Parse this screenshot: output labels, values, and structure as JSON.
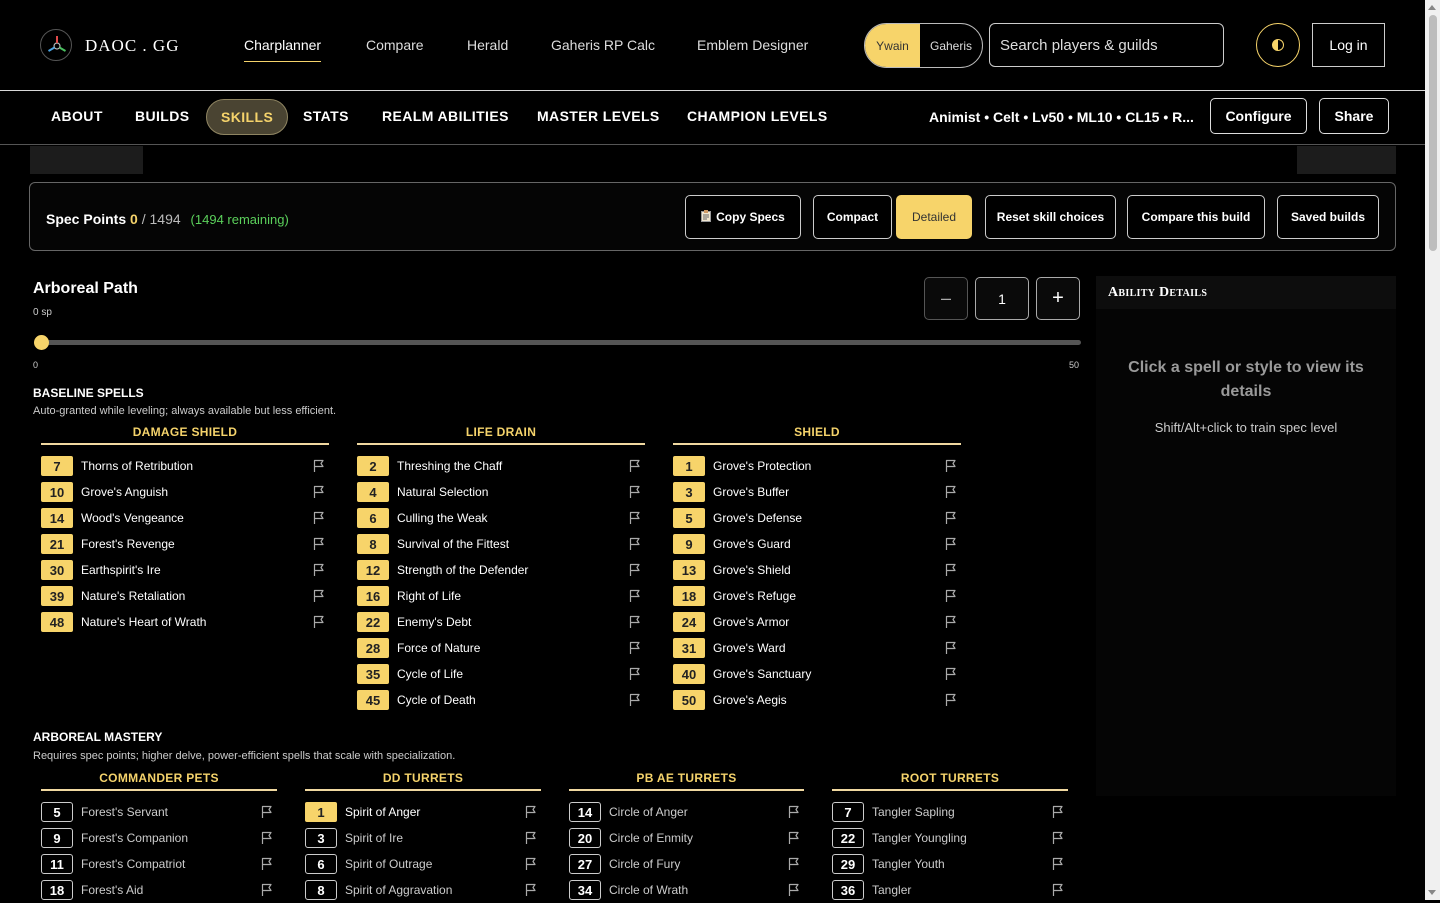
{
  "header": {
    "logo_text": "DAOC . GG",
    "nav": [
      "Charplanner",
      "Compare",
      "Herald",
      "Gaheris RP Calc",
      "Emblem Designer"
    ],
    "realm_options": [
      "Ywain",
      "Gaheris"
    ],
    "search_placeholder": "Search players & guilds",
    "login_label": "Log in"
  },
  "subnav": {
    "tabs": [
      "ABOUT",
      "BUILDS",
      "SKILLS",
      "STATS",
      "REALM ABILITIES",
      "MASTER LEVELS",
      "CHAMPION LEVELS"
    ],
    "active_tab": "SKILLS",
    "build_summary": "Animist • Celt • Lv50 • ML10 • CL15 • R...",
    "configure_label": "Configure",
    "share_label": "Share"
  },
  "spec": {
    "label": "Spec Points",
    "used": "0",
    "total": "/ 1494",
    "remaining": "(1494 remaining)",
    "buttons": [
      "Copy Specs",
      "Compact",
      "Detailed",
      "Reset skill choices",
      "Compare this build",
      "Saved builds"
    ],
    "active_view": "Detailed"
  },
  "tree": {
    "title": "Arboreal Path",
    "sp": "0 sp",
    "minus": "–",
    "level": "1",
    "plus": "+",
    "slider_min": "0",
    "slider_max": "50",
    "slider_value": 1
  },
  "baseline": {
    "title": "BASELINE SPELLS",
    "desc": "Auto-granted while leveling; always available but less efficient.",
    "columns": [
      {
        "title": "DAMAGE SHIELD",
        "spells": [
          {
            "lvl": "7",
            "name": "Thorns of Retribution"
          },
          {
            "lvl": "10",
            "name": "Grove's Anguish"
          },
          {
            "lvl": "14",
            "name": "Wood's Vengeance"
          },
          {
            "lvl": "21",
            "name": "Forest's Revenge"
          },
          {
            "lvl": "30",
            "name": "Earthspirit's Ire"
          },
          {
            "lvl": "39",
            "name": "Nature's Retaliation"
          },
          {
            "lvl": "48",
            "name": "Nature's Heart of Wrath"
          }
        ]
      },
      {
        "title": "LIFE DRAIN",
        "spells": [
          {
            "lvl": "2",
            "name": "Threshing the Chaff"
          },
          {
            "lvl": "4",
            "name": "Natural Selection"
          },
          {
            "lvl": "6",
            "name": "Culling the Weak"
          },
          {
            "lvl": "8",
            "name": "Survival of the Fittest"
          },
          {
            "lvl": "12",
            "name": "Strength of the Defender"
          },
          {
            "lvl": "16",
            "name": "Right of Life"
          },
          {
            "lvl": "22",
            "name": "Enemy's Debt"
          },
          {
            "lvl": "28",
            "name": "Force of Nature"
          },
          {
            "lvl": "35",
            "name": "Cycle of Life"
          },
          {
            "lvl": "45",
            "name": "Cycle of Death"
          }
        ]
      },
      {
        "title": "SHIELD",
        "spells": [
          {
            "lvl": "1",
            "name": "Grove's Protection"
          },
          {
            "lvl": "3",
            "name": "Grove's Buffer"
          },
          {
            "lvl": "5",
            "name": "Grove's Defense"
          },
          {
            "lvl": "9",
            "name": "Grove's Guard"
          },
          {
            "lvl": "13",
            "name": "Grove's Shield"
          },
          {
            "lvl": "18",
            "name": "Grove's Refuge"
          },
          {
            "lvl": "24",
            "name": "Grove's Armor"
          },
          {
            "lvl": "31",
            "name": "Grove's Ward"
          },
          {
            "lvl": "40",
            "name": "Grove's Sanctuary"
          },
          {
            "lvl": "50",
            "name": "Grove's Aegis"
          }
        ]
      }
    ]
  },
  "mastery": {
    "title": "ARBOREAL MASTERY",
    "desc": "Requires spec points; higher delve, power-efficient spells that scale with specialization.",
    "columns": [
      {
        "title": "COMMANDER PETS",
        "spells": [
          {
            "lvl": "5",
            "name": "Forest's Servant"
          },
          {
            "lvl": "9",
            "name": "Forest's Companion"
          },
          {
            "lvl": "11",
            "name": "Forest's Compatriot"
          },
          {
            "lvl": "18",
            "name": "Forest's Aid"
          }
        ]
      },
      {
        "title": "DD TURRETS",
        "spells": [
          {
            "lvl": "1",
            "name": "Spirit of Anger",
            "trained": true
          },
          {
            "lvl": "3",
            "name": "Spirit of Ire"
          },
          {
            "lvl": "6",
            "name": "Spirit of Outrage"
          },
          {
            "lvl": "8",
            "name": "Spirit of Aggravation"
          }
        ]
      },
      {
        "title": "PB AE TURRETS",
        "spells": [
          {
            "lvl": "14",
            "name": "Circle of Anger"
          },
          {
            "lvl": "20",
            "name": "Circle of Enmity"
          },
          {
            "lvl": "27",
            "name": "Circle of Fury"
          },
          {
            "lvl": "34",
            "name": "Circle of Wrath"
          }
        ]
      },
      {
        "title": "ROOT TURRETS",
        "spells": [
          {
            "lvl": "7",
            "name": "Tangler Sapling"
          },
          {
            "lvl": "22",
            "name": "Tangler Youngling"
          },
          {
            "lvl": "29",
            "name": "Tangler Youth"
          },
          {
            "lvl": "36",
            "name": "Tangler"
          }
        ]
      }
    ]
  },
  "details": {
    "title": "Ability Details",
    "hint": "Click a spell or style to view its details",
    "sub": "Shift/Alt+click to train spec level"
  },
  "colors": {
    "accent": "#f7d46a",
    "remaining": "#5bd05b",
    "background": "#000000"
  }
}
